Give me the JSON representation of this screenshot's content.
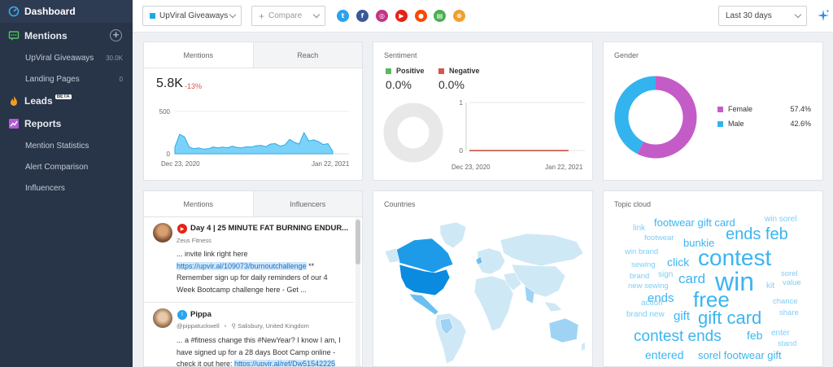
{
  "sidebar": {
    "dashboard": "Dashboard",
    "mentions": "Mentions",
    "mentions_items": [
      {
        "label": "UpViral Giveaways",
        "count": "30.0K"
      },
      {
        "label": "Landing Pages",
        "count": "0"
      }
    ],
    "leads": "Leads",
    "leads_badge": "BETA",
    "reports": "Reports",
    "reports_items": [
      "Mention Statistics",
      "Alert Comparison",
      "Influencers"
    ]
  },
  "topbar": {
    "project": "UpViral Giveaways",
    "compare": "Compare",
    "date_range": "Last 30 days",
    "sources": [
      "twitter-icon",
      "facebook-icon",
      "instagram-icon",
      "youtube-icon",
      "reddit-icon",
      "news-icon",
      "web-icon"
    ]
  },
  "mentions_card": {
    "tabs": [
      "Mentions",
      "Reach"
    ],
    "total": "5.8K",
    "change": "-13%",
    "date_start": "Dec 23, 2020",
    "date_end": "Jan 22, 2021",
    "chart_data": {
      "type": "area",
      "ylim": [
        0,
        500
      ],
      "y_ticks": [
        "500",
        "0"
      ],
      "values": [
        80,
        230,
        200,
        80,
        60,
        70,
        55,
        60,
        80,
        70,
        80,
        70,
        90,
        75,
        70,
        85,
        80,
        95,
        100,
        85,
        115,
        120,
        90,
        105,
        170,
        135,
        115,
        250,
        150,
        165,
        145,
        110,
        120,
        30
      ],
      "color": "#4fc3f7"
    }
  },
  "sentiment_card": {
    "title": "Sentiment",
    "positive_label": "Positive",
    "positive_value": "0.0%",
    "negative_label": "Negative",
    "negative_value": "0.0%",
    "date_start": "Dec 23, 2020",
    "date_end": "Jan 22, 2021",
    "chart_data": {
      "type": "line",
      "ylim": [
        0,
        1
      ],
      "y_ticks": [
        "1",
        "0"
      ],
      "series": [
        {
          "name": "Positive",
          "color": "#5cb85c",
          "values": [
            0,
            0
          ]
        },
        {
          "name": "Negative",
          "color": "#d9534f",
          "values": [
            0,
            0
          ]
        }
      ]
    }
  },
  "gender_card": {
    "title": "Gender",
    "chart_data": {
      "type": "pie",
      "labels": [
        "Female",
        "Male"
      ],
      "values": [
        57.4,
        42.6
      ],
      "display": [
        "57.4%",
        "42.6%"
      ],
      "colors": [
        "#c45cc8",
        "#33b4ef"
      ]
    }
  },
  "feed_card": {
    "tabs": [
      "Mentions",
      "Influencers"
    ],
    "items": [
      {
        "source_icon": "youtube-icon",
        "title": "Day 4 | 25 MINUTE FAT BURNING ENDUR...",
        "author": "Zeus Fitness",
        "body_1": "... invite link right here",
        "link": "https://upvir.al/109073/burnoutchallenge",
        "body_2": " ** Remember sign up for daily reminders of our 4 Week Bootcamp challenge here - Get ..."
      },
      {
        "source_icon": "twitter-icon",
        "title": "Pippa",
        "author": "@pippatuckwell",
        "location": "Salisbury, United Kingdom",
        "body_1": "... a #fitness change this #NewYear? I know I am, I have signed up for a 28 days Boot Camp online - check it out here: ",
        "link": "https://upvir.al/ref/Dw51542225"
      }
    ]
  },
  "countries_card": {
    "title": "Countries"
  },
  "topic_card": {
    "title": "Topic cloud",
    "words": [
      "footwear gift card",
      "win sorel",
      "link",
      "ends feb",
      "footwear",
      "bunkie",
      "win brand",
      "contest",
      "sewing",
      "click",
      "brand",
      "sign",
      "card",
      "sorel",
      "win",
      "new sewing",
      "value",
      "kit",
      "ends",
      "chance",
      "action",
      "free",
      "brand new",
      "gift",
      "gift card",
      "share",
      "contest ends",
      "feb",
      "enter",
      "stand",
      "entered",
      "sorel footwear gift"
    ]
  }
}
